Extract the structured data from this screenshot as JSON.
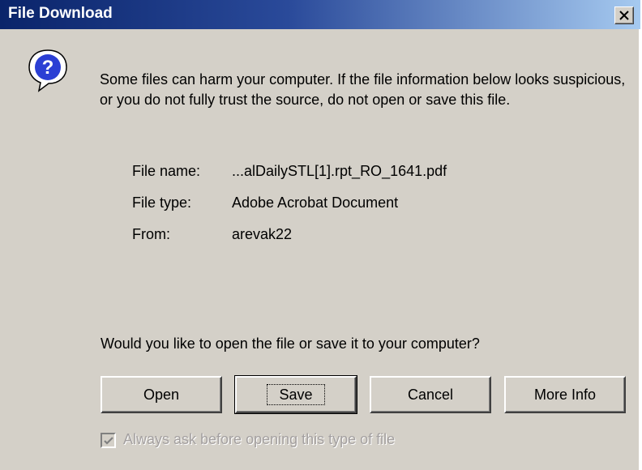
{
  "window": {
    "title": "File Download"
  },
  "message": "Some files can harm your computer. If the file information below looks suspicious, or you do not fully trust the source, do not open or save this file.",
  "file_info": [
    {
      "label": "File name:",
      "value": "...alDailySTL[1].rpt_RO_1641.pdf"
    },
    {
      "label": "File type:",
      "value": "Adobe Acrobat Document"
    },
    {
      "label": "From:",
      "value": "arevak22"
    }
  ],
  "question": "Would you like to open the file or save it to your computer?",
  "buttons": {
    "open": "Open",
    "save": "Save",
    "cancel": "Cancel",
    "more_info": "More Info"
  },
  "checkbox": {
    "label": "Always ask before opening this type of file",
    "checked": true,
    "enabled": false
  },
  "icons": {
    "title_close": "close-icon",
    "dialog": "question-icon"
  },
  "colors": {
    "title_bar_start": "#0a246a",
    "title_bar_end": "#a6caf0",
    "dialog_bg": "#d4d0c8"
  }
}
